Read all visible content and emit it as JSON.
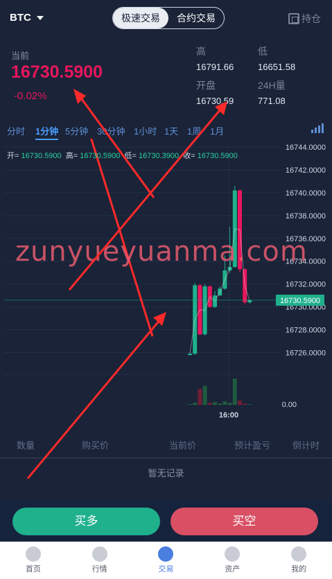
{
  "header": {
    "coin": "BTC",
    "segments": [
      "极速交易",
      "合约交易"
    ],
    "hold_label": "持仓"
  },
  "price": {
    "current_label": "当前",
    "current_value": "16730.5900",
    "change": "-0.02%",
    "high_label": "高",
    "high_value": "16791.66",
    "low_label": "低",
    "low_value": "16651.58",
    "open_label": "开盘",
    "open_value": "16730.59",
    "vol_label": "24H量",
    "vol_value": "771.08"
  },
  "periods": [
    "分时",
    "1分钟",
    "5分钟",
    "30分钟",
    "1小时",
    "1天",
    "1周",
    "1月"
  ],
  "active_period": "1分钟",
  "ohlc": {
    "open_label": "开=",
    "open_value": "16730.5900",
    "high_label": "高=",
    "high_value": "16730.5900",
    "low_label": "低=",
    "low_value": "16730.3900",
    "close_label": "收=",
    "close_value": "16730.5900"
  },
  "chart_data": {
    "type": "candlestick",
    "y_ticks": [
      "16744.0000",
      "16742.0000",
      "16740.0000",
      "16738.0000",
      "16736.0000",
      "16734.0000",
      "16732.0000",
      "16730.0000",
      "16728.0000",
      "16726.0000"
    ],
    "ylim": [
      16725.0,
      16744.0
    ],
    "last_price_label": "16730.5900",
    "last_price": 16730.59,
    "x_label": "16:00",
    "volume_tick": "0.00",
    "candles": [
      {
        "o": 16725.9,
        "h": 16726.0,
        "l": 16725.8,
        "c": 16725.9
      },
      {
        "o": 16725.9,
        "h": 16732.1,
        "l": 16725.8,
        "c": 16731.9
      },
      {
        "o": 16731.9,
        "h": 16732.0,
        "l": 16727.5,
        "c": 16727.6
      },
      {
        "o": 16727.6,
        "h": 16732.0,
        "l": 16727.5,
        "c": 16731.8
      },
      {
        "o": 16731.8,
        "h": 16731.9,
        "l": 16729.9,
        "c": 16730.0
      },
      {
        "o": 16730.0,
        "h": 16731.4,
        "l": 16729.9,
        "c": 16731.0
      },
      {
        "o": 16731.0,
        "h": 16731.8,
        "l": 16731.0,
        "c": 16731.6
      },
      {
        "o": 16731.6,
        "h": 16734.5,
        "l": 16731.5,
        "c": 16733.2
      },
      {
        "o": 16733.2,
        "h": 16737.0,
        "l": 16733.0,
        "c": 16733.5
      },
      {
        "o": 16733.5,
        "h": 16740.6,
        "l": 16733.4,
        "c": 16740.2
      },
      {
        "o": 16740.2,
        "h": 16740.3,
        "l": 16733.0,
        "c": 16733.3
      },
      {
        "o": 16733.3,
        "h": 16733.4,
        "l": 16730.2,
        "c": 16730.4
      },
      {
        "o": 16730.4,
        "h": 16730.6,
        "l": 16730.3,
        "c": 16730.59
      }
    ],
    "volumes": [
      0.1,
      0.3,
      2.2,
      2.6,
      0.3,
      0.4,
      0.2,
      0.5,
      0.3,
      3.6,
      0.6,
      0.2,
      0.1
    ]
  },
  "table": {
    "columns": [
      "数量",
      "购买价",
      "当前价",
      "预计盈亏",
      "倒计时"
    ],
    "empty_text": "暂无记录"
  },
  "actions": {
    "buy_label": "买多",
    "sell_label": "买空"
  },
  "tabs": [
    "首页",
    "行情",
    "交易",
    "资产",
    "我的"
  ],
  "active_tab": "交易",
  "watermark": "zunyueyuanma.com",
  "colors": {
    "up": "#1fb08c",
    "down": "#e8175d",
    "accent": "#4a9dff"
  }
}
